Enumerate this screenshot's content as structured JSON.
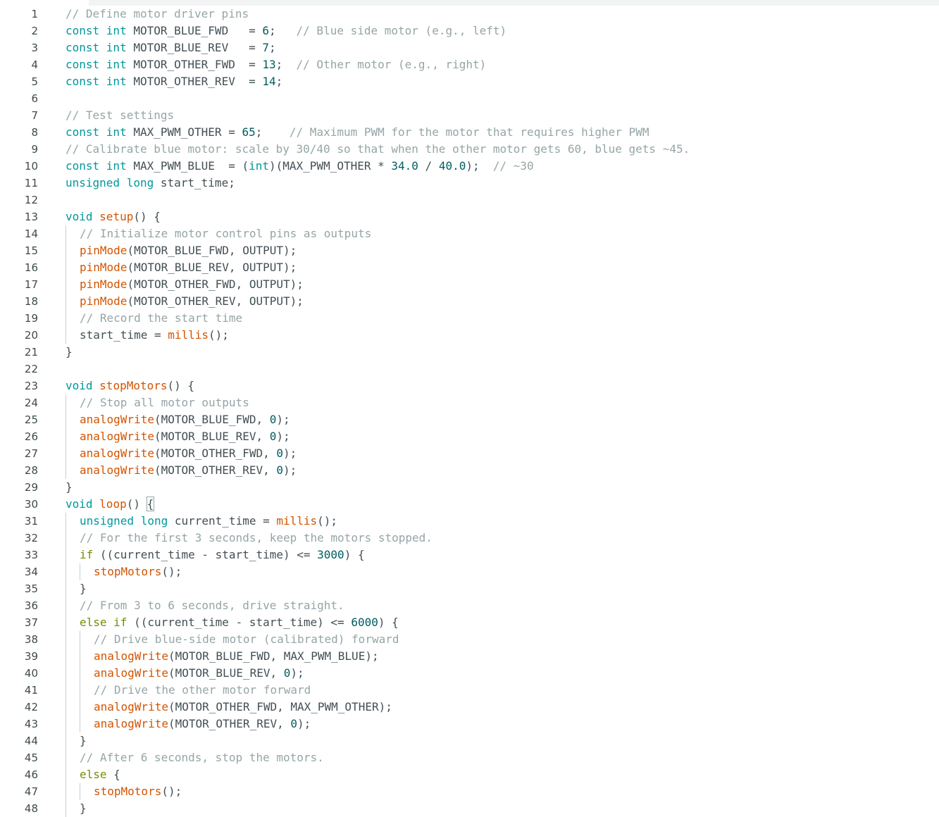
{
  "editor": {
    "lines": [
      {
        "n": "1",
        "indent": 0,
        "guides": 0,
        "tokens": [
          [
            "com",
            "// Define motor driver pins"
          ]
        ]
      },
      {
        "n": "2",
        "indent": 0,
        "guides": 0,
        "tokens": [
          [
            "kw",
            "const int"
          ],
          [
            "pl",
            " MOTOR_BLUE_FWD   = "
          ],
          [
            "num",
            "6"
          ],
          [
            "pl",
            ";   "
          ],
          [
            "com",
            "// Blue side motor (e.g., left)"
          ]
        ]
      },
      {
        "n": "3",
        "indent": 0,
        "guides": 0,
        "tokens": [
          [
            "kw",
            "const int"
          ],
          [
            "pl",
            " MOTOR_BLUE_REV   = "
          ],
          [
            "num",
            "7"
          ],
          [
            "pl",
            ";"
          ]
        ]
      },
      {
        "n": "4",
        "indent": 0,
        "guides": 0,
        "tokens": [
          [
            "kw",
            "const int"
          ],
          [
            "pl",
            " MOTOR_OTHER_FWD  = "
          ],
          [
            "num",
            "13"
          ],
          [
            "pl",
            ";  "
          ],
          [
            "com",
            "// Other motor (e.g., right)"
          ]
        ]
      },
      {
        "n": "5",
        "indent": 0,
        "guides": 0,
        "tokens": [
          [
            "kw",
            "const int"
          ],
          [
            "pl",
            " MOTOR_OTHER_REV  = "
          ],
          [
            "num",
            "14"
          ],
          [
            "pl",
            ";"
          ]
        ]
      },
      {
        "n": "6",
        "indent": 0,
        "guides": 0,
        "tokens": []
      },
      {
        "n": "7",
        "indent": 0,
        "guides": 0,
        "tokens": [
          [
            "com",
            "// Test settings"
          ]
        ]
      },
      {
        "n": "8",
        "indent": 0,
        "guides": 0,
        "tokens": [
          [
            "kw",
            "const int"
          ],
          [
            "pl",
            " MAX_PWM_OTHER = "
          ],
          [
            "num",
            "65"
          ],
          [
            "pl",
            ";    "
          ],
          [
            "com",
            "// Maximum PWM for the motor that requires higher PWM"
          ]
        ]
      },
      {
        "n": "9",
        "indent": 0,
        "guides": 0,
        "tokens": [
          [
            "com",
            "// Calibrate blue motor: scale by 30/40 so that when the other motor gets 60, blue gets ~45."
          ]
        ]
      },
      {
        "n": "10",
        "indent": 0,
        "guides": 0,
        "tokens": [
          [
            "kw",
            "const int"
          ],
          [
            "pl",
            " MAX_PWM_BLUE  = ("
          ],
          [
            "kw",
            "int"
          ],
          [
            "pl",
            ")(MAX_PWM_OTHER * "
          ],
          [
            "num",
            "34.0"
          ],
          [
            "pl",
            " / "
          ],
          [
            "num",
            "40.0"
          ],
          [
            "pl",
            ");  "
          ],
          [
            "com",
            "// ~30"
          ]
        ]
      },
      {
        "n": "11",
        "indent": 0,
        "guides": 0,
        "tokens": [
          [
            "kw",
            "unsigned long"
          ],
          [
            "pl",
            " start_time;"
          ]
        ]
      },
      {
        "n": "12",
        "indent": 0,
        "guides": 0,
        "tokens": []
      },
      {
        "n": "13",
        "indent": 0,
        "guides": 0,
        "tokens": [
          [
            "kw",
            "void"
          ],
          [
            "pl",
            " "
          ],
          [
            "fn",
            "setup"
          ],
          [
            "pl",
            "() {"
          ]
        ]
      },
      {
        "n": "14",
        "indent": 1,
        "guides": 1,
        "tokens": [
          [
            "com",
            "// Initialize motor control pins as outputs"
          ]
        ]
      },
      {
        "n": "15",
        "indent": 1,
        "guides": 1,
        "tokens": [
          [
            "fn",
            "pinMode"
          ],
          [
            "pl",
            "(MOTOR_BLUE_FWD, OUTPUT);"
          ]
        ]
      },
      {
        "n": "16",
        "indent": 1,
        "guides": 1,
        "tokens": [
          [
            "fn",
            "pinMode"
          ],
          [
            "pl",
            "(MOTOR_BLUE_REV, OUTPUT);"
          ]
        ]
      },
      {
        "n": "17",
        "indent": 1,
        "guides": 1,
        "tokens": [
          [
            "fn",
            "pinMode"
          ],
          [
            "pl",
            "(MOTOR_OTHER_FWD, OUTPUT);"
          ]
        ]
      },
      {
        "n": "18",
        "indent": 1,
        "guides": 1,
        "tokens": [
          [
            "fn",
            "pinMode"
          ],
          [
            "pl",
            "(MOTOR_OTHER_REV, OUTPUT);"
          ]
        ]
      },
      {
        "n": "19",
        "indent": 1,
        "guides": 1,
        "tokens": [
          [
            "com",
            "// Record the start time"
          ]
        ]
      },
      {
        "n": "20",
        "indent": 1,
        "guides": 1,
        "tokens": [
          [
            "pl",
            "start_time = "
          ],
          [
            "fn",
            "millis"
          ],
          [
            "pl",
            "();"
          ]
        ]
      },
      {
        "n": "21",
        "indent": 0,
        "guides": 0,
        "tokens": [
          [
            "pl",
            "}"
          ]
        ]
      },
      {
        "n": "22",
        "indent": 0,
        "guides": 0,
        "tokens": []
      },
      {
        "n": "23",
        "indent": 0,
        "guides": 0,
        "tokens": [
          [
            "kw",
            "void"
          ],
          [
            "pl",
            " "
          ],
          [
            "fn",
            "stopMotors"
          ],
          [
            "pl",
            "() {"
          ]
        ]
      },
      {
        "n": "24",
        "indent": 1,
        "guides": 1,
        "tokens": [
          [
            "com",
            "// Stop all motor outputs"
          ]
        ]
      },
      {
        "n": "25",
        "indent": 1,
        "guides": 1,
        "tokens": [
          [
            "fn",
            "analogWrite"
          ],
          [
            "pl",
            "(MOTOR_BLUE_FWD, "
          ],
          [
            "num",
            "0"
          ],
          [
            "pl",
            ");"
          ]
        ]
      },
      {
        "n": "26",
        "indent": 1,
        "guides": 1,
        "tokens": [
          [
            "fn",
            "analogWrite"
          ],
          [
            "pl",
            "(MOTOR_BLUE_REV, "
          ],
          [
            "num",
            "0"
          ],
          [
            "pl",
            ");"
          ]
        ]
      },
      {
        "n": "27",
        "indent": 1,
        "guides": 1,
        "tokens": [
          [
            "fn",
            "analogWrite"
          ],
          [
            "pl",
            "(MOTOR_OTHER_FWD, "
          ],
          [
            "num",
            "0"
          ],
          [
            "pl",
            ");"
          ]
        ]
      },
      {
        "n": "28",
        "indent": 1,
        "guides": 1,
        "tokens": [
          [
            "fn",
            "analogWrite"
          ],
          [
            "pl",
            "(MOTOR_OTHER_REV, "
          ],
          [
            "num",
            "0"
          ],
          [
            "pl",
            ");"
          ]
        ]
      },
      {
        "n": "29",
        "indent": 0,
        "guides": 0,
        "tokens": [
          [
            "pl",
            "}"
          ]
        ]
      },
      {
        "n": "30",
        "indent": 0,
        "guides": 0,
        "tokens": [
          [
            "kw",
            "void"
          ],
          [
            "pl",
            " "
          ],
          [
            "fn",
            "loop"
          ],
          [
            "pl",
            "() "
          ],
          [
            "brk",
            "{"
          ]
        ]
      },
      {
        "n": "31",
        "indent": 1,
        "guides": 1,
        "tokens": [
          [
            "kw",
            "unsigned long"
          ],
          [
            "pl",
            " current_time = "
          ],
          [
            "fn",
            "millis"
          ],
          [
            "pl",
            "();"
          ]
        ]
      },
      {
        "n": "32",
        "indent": 1,
        "guides": 1,
        "tokens": [
          [
            "com",
            "// For the first 3 seconds, keep the motors stopped."
          ]
        ]
      },
      {
        "n": "33",
        "indent": 1,
        "guides": 1,
        "tokens": [
          [
            "ctl",
            "if"
          ],
          [
            "pl",
            " ((current_time - start_time) <= "
          ],
          [
            "num",
            "3000"
          ],
          [
            "pl",
            ") {"
          ]
        ]
      },
      {
        "n": "34",
        "indent": 2,
        "guides": 2,
        "tokens": [
          [
            "fn",
            "stopMotors"
          ],
          [
            "pl",
            "();"
          ]
        ]
      },
      {
        "n": "35",
        "indent": 1,
        "guides": 1,
        "tokens": [
          [
            "pl",
            "}"
          ]
        ]
      },
      {
        "n": "36",
        "indent": 1,
        "guides": 1,
        "tokens": [
          [
            "com",
            "// From 3 to 6 seconds, drive straight."
          ]
        ]
      },
      {
        "n": "37",
        "indent": 1,
        "guides": 1,
        "tokens": [
          [
            "ctl",
            "else if"
          ],
          [
            "pl",
            " ((current_time - start_time) <= "
          ],
          [
            "num",
            "6000"
          ],
          [
            "pl",
            ") {"
          ]
        ]
      },
      {
        "n": "38",
        "indent": 2,
        "guides": 2,
        "tokens": [
          [
            "com",
            "// Drive blue-side motor (calibrated) forward"
          ]
        ]
      },
      {
        "n": "39",
        "indent": 2,
        "guides": 2,
        "tokens": [
          [
            "fn",
            "analogWrite"
          ],
          [
            "pl",
            "(MOTOR_BLUE_FWD, MAX_PWM_BLUE);"
          ]
        ]
      },
      {
        "n": "40",
        "indent": 2,
        "guides": 2,
        "tokens": [
          [
            "fn",
            "analogWrite"
          ],
          [
            "pl",
            "(MOTOR_BLUE_REV, "
          ],
          [
            "num",
            "0"
          ],
          [
            "pl",
            ");"
          ]
        ]
      },
      {
        "n": "41",
        "indent": 2,
        "guides": 2,
        "tokens": [
          [
            "com",
            "// Drive the other motor forward"
          ]
        ]
      },
      {
        "n": "42",
        "indent": 2,
        "guides": 2,
        "tokens": [
          [
            "fn",
            "analogWrite"
          ],
          [
            "pl",
            "(MOTOR_OTHER_FWD, MAX_PWM_OTHER);"
          ]
        ]
      },
      {
        "n": "43",
        "indent": 2,
        "guides": 2,
        "tokens": [
          [
            "fn",
            "analogWrite"
          ],
          [
            "pl",
            "(MOTOR_OTHER_REV, "
          ],
          [
            "num",
            "0"
          ],
          [
            "pl",
            ");"
          ]
        ]
      },
      {
        "n": "44",
        "indent": 1,
        "guides": 1,
        "tokens": [
          [
            "pl",
            "}"
          ]
        ]
      },
      {
        "n": "45",
        "indent": 1,
        "guides": 1,
        "tokens": [
          [
            "com",
            "// After 6 seconds, stop the motors."
          ]
        ]
      },
      {
        "n": "46",
        "indent": 1,
        "guides": 1,
        "tokens": [
          [
            "ctl",
            "else"
          ],
          [
            "pl",
            " {"
          ]
        ]
      },
      {
        "n": "47",
        "indent": 2,
        "guides": 2,
        "tokens": [
          [
            "fn",
            "stopMotors"
          ],
          [
            "pl",
            "();"
          ]
        ]
      },
      {
        "n": "48",
        "indent": 1,
        "guides": 1,
        "tokens": [
          [
            "pl",
            "}"
          ]
        ]
      }
    ]
  },
  "colors": {
    "comment": "#95a5a6",
    "keyword": "#00979c",
    "control": "#728e00",
    "function": "#d35400",
    "number": "#005c5f",
    "plain": "#434f54",
    "line_number": "#3e4a4e"
  }
}
